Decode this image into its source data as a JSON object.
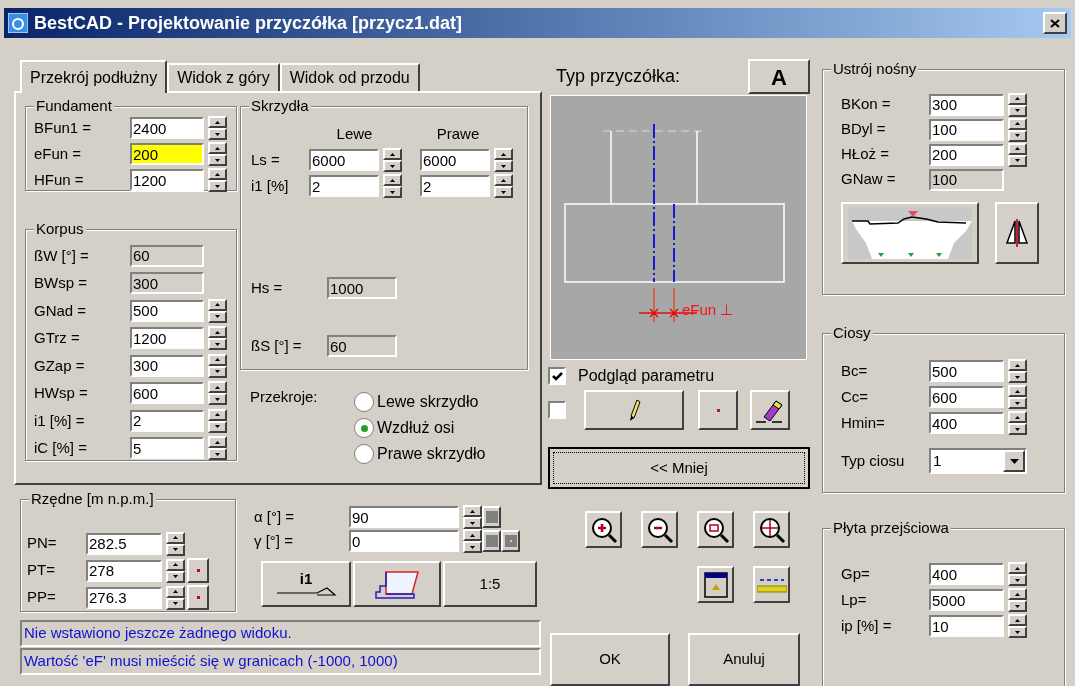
{
  "window": {
    "title": "BestCAD - Projektowanie przyczółka [przycz1.dat]"
  },
  "tabs": [
    {
      "label": "Przekrój podłużny",
      "selected": true
    },
    {
      "label": "Widok z góry",
      "selected": false
    },
    {
      "label": "Widok od przodu",
      "selected": false
    }
  ],
  "fundament": {
    "title": "Fundament",
    "fields": [
      {
        "label": "BFun1 =",
        "value": "2400",
        "kind": "spin",
        "highlighted": false
      },
      {
        "label": "eFun =",
        "value": "200",
        "kind": "spin",
        "highlighted": true
      },
      {
        "label": "HFun =",
        "value": "1200",
        "kind": "spin",
        "highlighted": false
      }
    ]
  },
  "korpus": {
    "title": "Korpus",
    "fields": [
      {
        "label": "ßW [°] =",
        "value": "60",
        "kind": "readonly"
      },
      {
        "label": "BWsp =",
        "value": "300",
        "kind": "readonly"
      },
      {
        "label": "GNad =",
        "value": "500",
        "kind": "spin"
      },
      {
        "label": "GTrz =",
        "value": "1200",
        "kind": "spin"
      },
      {
        "label": "GZap =",
        "value": "300",
        "kind": "spin"
      },
      {
        "label": "HWsp =",
        "value": "600",
        "kind": "spin"
      },
      {
        "label": "i1 [%] =",
        "value": "2",
        "kind": "spin"
      },
      {
        "label": "iC [%] =",
        "value": "5",
        "kind": "spin"
      }
    ]
  },
  "wings": {
    "title": "Skrzydła",
    "columns": [
      "Lewe",
      "Prawe"
    ],
    "rows": [
      {
        "label": "Ls =",
        "values": [
          "6000",
          "6000"
        ]
      },
      {
        "label": "i1 [%]",
        "values": [
          "2",
          "2"
        ]
      }
    ],
    "hs": {
      "label": "Hs =",
      "value": "1000"
    },
    "bs": {
      "label": "ßS [°] =",
      "value": "60"
    }
  },
  "sections": {
    "label": "Przekroje:",
    "options": [
      {
        "label": "Lewe skrzydło",
        "selected": false
      },
      {
        "label": "Wzdłuż osi",
        "selected": true
      },
      {
        "label": "Prawe skrzydło",
        "selected": false
      }
    ]
  },
  "elevations": {
    "title": "Rzędne [m n.p.m.]",
    "fields": [
      {
        "label": "PN=",
        "value": "282.5",
        "picker": false
      },
      {
        "label": "PT=",
        "value": "278",
        "picker": true
      },
      {
        "label": "PP=",
        "value": "276.3",
        "picker": true
      }
    ]
  },
  "angles": [
    {
      "label": "α [°] =",
      "value": "90"
    },
    {
      "label": "γ [°] =",
      "value": "0"
    }
  ],
  "view_buttons": [
    {
      "kind": "slope",
      "label": "i1"
    },
    {
      "kind": "profile"
    },
    {
      "kind": "scale",
      "label": "1:5"
    }
  ],
  "status": [
    "Nie wstawiono jeszcze żadnego widoku.",
    "Wartość 'eF' musi mieścić się w granicach (-1000, 1000)"
  ],
  "preview": {
    "title": "Typ przyczółka:",
    "type_button": "A",
    "annotation": "eFun ⊥"
  },
  "preview_option": {
    "label": "Podgląd parametru",
    "checked": true
  },
  "edit_option": {
    "checked": false
  },
  "toggle_button": "<< Mniej",
  "ok_button": "OK",
  "cancel_button": "Anuluj",
  "superstructure": {
    "title": "Ustrój nośny",
    "fields": [
      {
        "label": "BKon =",
        "value": "300",
        "kind": "spin"
      },
      {
        "label": "BDyl =",
        "value": "100",
        "kind": "spin"
      },
      {
        "label": "HŁoż =",
        "value": "200",
        "kind": "spin"
      },
      {
        "label": "GNaw =",
        "value": "100",
        "kind": "readonly"
      }
    ]
  },
  "abutments": {
    "title": "Ciosy",
    "fields": [
      {
        "label": "Bc=",
        "value": "500",
        "kind": "spin"
      },
      {
        "label": "Cc=",
        "value": "600",
        "kind": "spin"
      },
      {
        "label": "Hmin=",
        "value": "400",
        "kind": "spin"
      }
    ],
    "type": {
      "label": "Typ ciosu",
      "value": "1"
    }
  },
  "slab": {
    "title": "Płyta przejściowa",
    "fields": [
      {
        "label": "Gp=",
        "value": "400",
        "kind": "spin"
      },
      {
        "label": "Lp=",
        "value": "5000",
        "kind": "spin"
      },
      {
        "label": "ip [%] =",
        "value": "10",
        "kind": "spin"
      }
    ]
  }
}
